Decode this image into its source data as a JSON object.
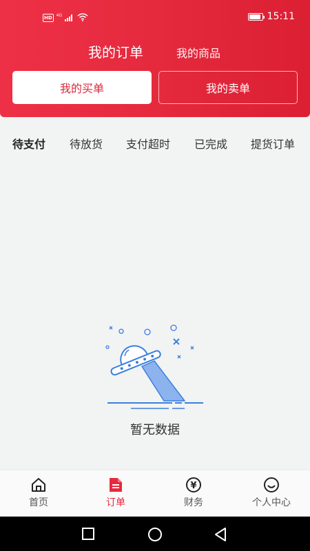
{
  "statusbar": {
    "network_badge": "HD",
    "network_type": "4G",
    "battery_level": 0.9,
    "time": "15:11"
  },
  "top_tabs": {
    "active": "我的订单",
    "inactive": "我的商品"
  },
  "segment": {
    "buy": "我的买单",
    "sell": "我的卖单"
  },
  "status_tabs": [
    "待支付",
    "待放货",
    "支付超时",
    "已完成",
    "提货订单"
  ],
  "empty": {
    "text": "暂无数据",
    "icon": "ufo-illustration"
  },
  "bottom_nav": [
    {
      "label": "首页",
      "icon": "home-icon",
      "active": false
    },
    {
      "label": "订单",
      "icon": "order-document-icon",
      "active": true
    },
    {
      "label": "财务",
      "icon": "yuan-coin-icon",
      "active": false
    },
    {
      "label": "个人中心",
      "icon": "smiley-face-icon",
      "active": false
    }
  ],
  "colors": {
    "brand_red": "#e52a3e",
    "illustration_blue": "#3a7ee0",
    "page_bg": "#f2f3f3"
  }
}
